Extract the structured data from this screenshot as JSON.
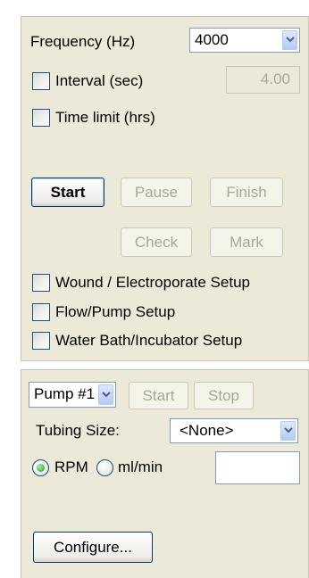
{
  "recording_panel": {
    "frequency_label": "Frequency (Hz)",
    "frequency_value": "4000",
    "interval_label": "Interval (sec)",
    "interval_value": "4.00",
    "time_limit_label": "Time limit (hrs)",
    "buttons": {
      "start": "Start",
      "pause": "Pause",
      "finish": "Finish",
      "check": "Check",
      "mark": "Mark"
    },
    "setup_options": [
      "Wound / Electroporate Setup",
      "Flow/Pump Setup",
      "Water Bath/Incubator Setup"
    ]
  },
  "pump_panel": {
    "pump_select_value": "Pump #1",
    "start_label": "Start",
    "stop_label": "Stop",
    "tubing_label": "Tubing Size:",
    "tubing_value": "<None>",
    "rpm_label": "RPM",
    "mlmin_label": "ml/min",
    "rate_value": "",
    "configure_label": "Configure..."
  },
  "colors": {
    "panel_bg": "#ece9d8",
    "control_border": "#7f9db9",
    "disabled_text": "#a8a698",
    "radio_selected": "#21a121"
  },
  "state": {
    "interval_checked": false,
    "time_limit_checked": false,
    "setup_checked": [
      false,
      false,
      false
    ],
    "rate_unit_selected": "RPM"
  }
}
